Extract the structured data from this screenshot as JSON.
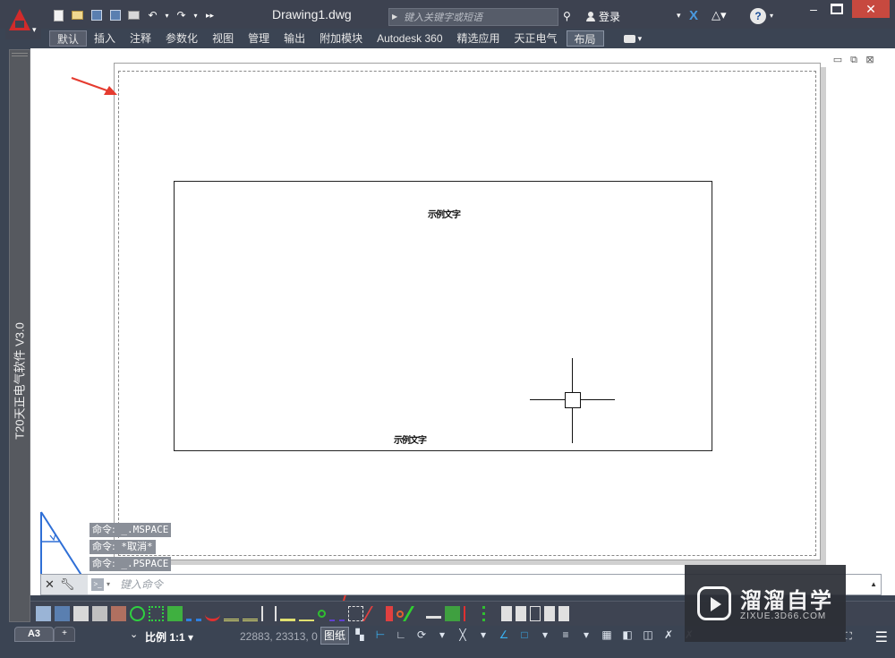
{
  "titlebar": {
    "doc_title": "Drawing1.dwg",
    "search_placeholder": "键入关键字或短语",
    "login_label": "登录",
    "help_label": "?"
  },
  "ribbon": {
    "tabs": [
      "默认",
      "插入",
      "注释",
      "参数化",
      "视图",
      "管理",
      "输出",
      "附加模块",
      "Autodesk 360",
      "精选应用",
      "天正电气",
      "布局"
    ],
    "active_tab": "默认"
  },
  "left_panel": {
    "label": "T20天正电气软件 V3.0"
  },
  "drawing": {
    "viewport_text_top": "示例文字",
    "viewport_text_bottom": "示例文字"
  },
  "command_history": [
    {
      "label": "命令:",
      "text": "_.MSPACE"
    },
    {
      "label": "命令:",
      "text": "*取消*"
    },
    {
      "label": "命令:",
      "text": "_.PSPACE"
    }
  ],
  "command_line": {
    "placeholder": "键入命令"
  },
  "statusbar": {
    "layout_tab": "A3",
    "add_tab": "+",
    "scale": "比例 1:1",
    "coords": "22883, 23313, 0",
    "paper_button": "图纸"
  },
  "watermark": {
    "title": "溜溜自学",
    "subtitle": "ZIXUE.3D66.COM"
  },
  "colors": {
    "accent_red": "#d22b2b",
    "annotation_arrow": "#e53b2f",
    "close_button": "#c7493f"
  }
}
